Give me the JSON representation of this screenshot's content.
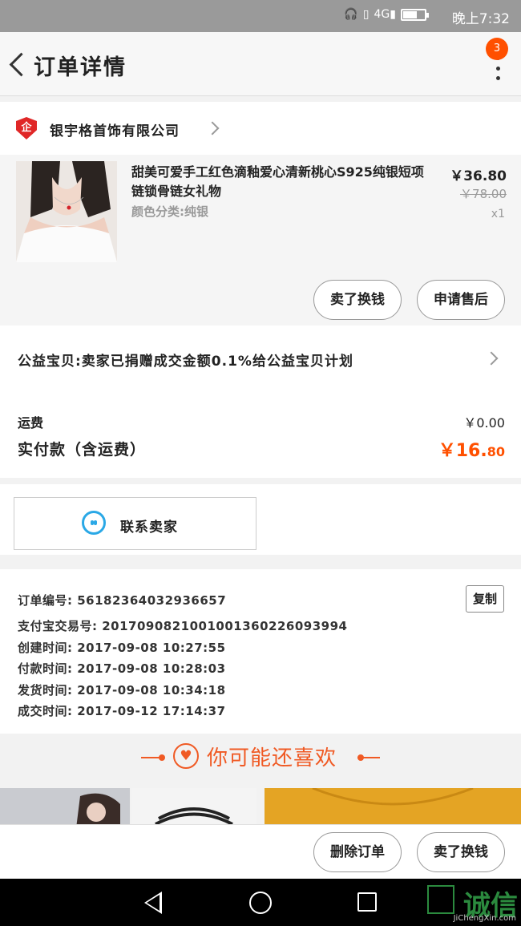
{
  "status_bar": {
    "icons": [
      "headset-icon",
      "vibrate-icon",
      "signal-4g-icon",
      "battery-icon"
    ],
    "network": "4G",
    "battery_level": 0.6,
    "time": "晚上7:32"
  },
  "nav": {
    "title": "订单详情",
    "badge_count": "3"
  },
  "shop": {
    "icon_text": "企",
    "name": "银宇格首饰有限公司"
  },
  "item": {
    "title": "甜美可爱手工红色滴釉爱心清新桃心S925纯银短项链锁骨链女礼物",
    "spec": "颜色分类:纯银",
    "price": "￥36.80",
    "original_price": "￥78.00",
    "qty": "x1",
    "buttons": [
      "卖了换钱",
      "申请售后"
    ]
  },
  "charity": {
    "text": "公益宝贝:卖家已捐赠成交金额0.1%给公益宝贝计划"
  },
  "fees": {
    "shipping_label": "运费",
    "shipping_value": "￥0.00",
    "paid_label": "实付款（含运费）",
    "paid_symbol": "￥",
    "paid_int": "16.",
    "paid_dec": "80"
  },
  "contact": {
    "label": "联系卖家"
  },
  "order_info": {
    "lines": [
      "订单编号: 56182364032936657",
      "支付宝交易号: 2017090821001001360226093994",
      "创建时间: 2017-09-08 10:27:55",
      "付款时间: 2017-09-08 10:28:03",
      "发货时间: 2017-09-08 10:34:18",
      "成交时间: 2017-09-12 17:14:37"
    ],
    "copy_label": "复制"
  },
  "guess": {
    "icon": "heart-icon",
    "text": "你可能还喜欢"
  },
  "bottom_bar": {
    "buttons": [
      "删除订单",
      "卖了换钱"
    ]
  },
  "watermark": {
    "text": "诚信",
    "sub": "JiChengXin.com"
  },
  "colors": {
    "accent": "#ff5000",
    "guess_accent": "#f05a24",
    "contact_icon": "#2aa8e6"
  }
}
